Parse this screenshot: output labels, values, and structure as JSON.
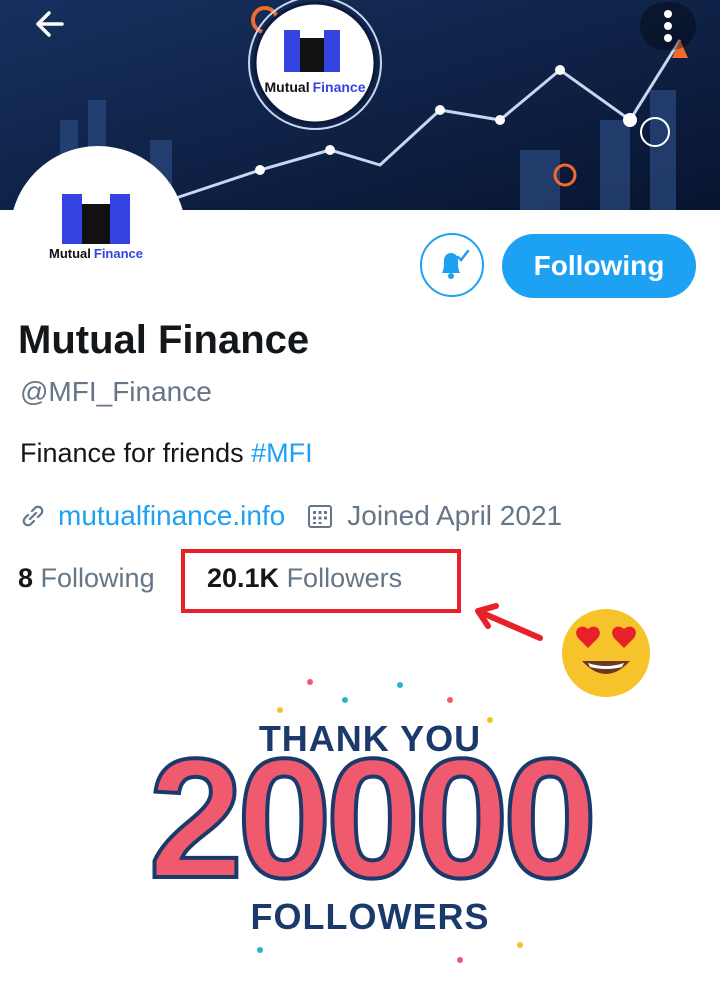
{
  "banner": {
    "logo_text_part1": "Mutual",
    "logo_text_part2": "Finance"
  },
  "avatar": {
    "logo_text_part1": "Mutual",
    "logo_text_part2": "Finance"
  },
  "profile": {
    "name": "Mutual Finance",
    "handle": "@MFI_Finance",
    "bio_text": "Finance for friends ",
    "bio_hashtag": "#MFI",
    "website": "mutualfinance.info",
    "joined": "Joined April 2021",
    "following_count": "8",
    "following_label": " Following",
    "followers_count": "20.1K",
    "followers_label": " Followers"
  },
  "actions": {
    "follow_label": "Following"
  },
  "celebration": {
    "line1": "THANK YOU",
    "number": "20000",
    "line2": "FOLLOWERS"
  },
  "colors": {
    "accent": "#1da1f2",
    "highlight": "#e8202a",
    "banner": "#0b1a3a"
  },
  "icons": {
    "back": "back-arrow-icon",
    "more": "more-vertical-icon",
    "bell": "notification-bell-icon",
    "link": "link-icon",
    "calendar": "calendar-icon",
    "emoji": "heart-eyes-emoji"
  }
}
